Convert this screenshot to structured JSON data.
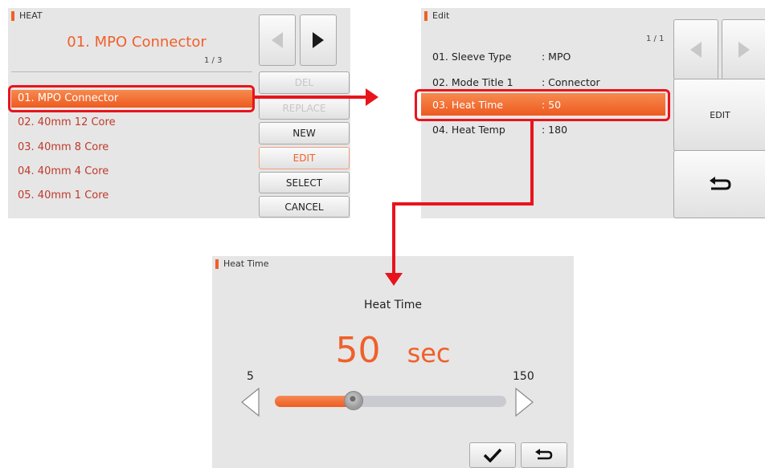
{
  "heat_list_panel": {
    "header": "HEAT",
    "title": "01. MPO Connector",
    "page": "1 / 3",
    "items": [
      "01. MPO Connector",
      "02. 40mm 12 Core",
      "03. 40mm 8 Core",
      "04. 40mm 4 Core",
      "05. 40mm 1 Core"
    ],
    "buttons": {
      "del": "DEL",
      "replace": "REPLACE",
      "new": "NEW",
      "edit": "EDIT",
      "select": "SELECT",
      "cancel": "CANCEL"
    }
  },
  "edit_panel": {
    "header": "Edit",
    "page": "1 / 1",
    "rows": [
      {
        "name": "01.  Sleeve Type",
        "value": ": MPO"
      },
      {
        "name": "02.  Mode Title 1",
        "value": ": Connector"
      },
      {
        "name": "03.  Heat Time",
        "value": ": 50"
      },
      {
        "name": "04.  Heat Temp",
        "value": ": 180"
      }
    ],
    "edit_button": "EDIT"
  },
  "heat_time_panel": {
    "header": "Heat Time",
    "label": "Heat Time",
    "value": "50",
    "unit": "sec",
    "min": "5",
    "max": "150",
    "slider_fraction": 0.32
  },
  "colors": {
    "accent": "#f0602a",
    "highlight": "#e8141c",
    "list_text": "#c0392b"
  }
}
